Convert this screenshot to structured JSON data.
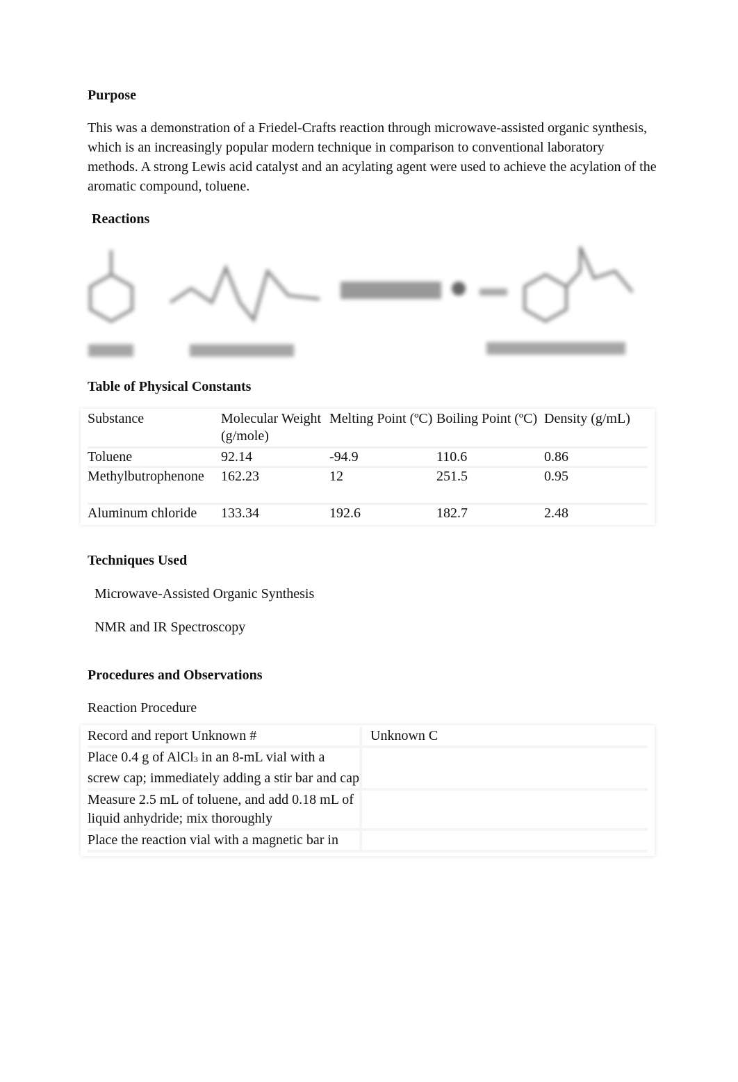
{
  "purpose": {
    "heading": "Purpose",
    "text": "This was a demonstration of a Friedel-Crafts reaction through microwave-assisted organic synthesis, which is an increasingly popular modern technique in comparison to conventional laboratory methods. A strong Lewis acid catalyst and an acylating agent were used to achieve the acylation of the aromatic compound, toluene."
  },
  "reactions": {
    "heading": "Reactions"
  },
  "constants": {
    "heading": "Table of Physical Constants",
    "columns": [
      "Substance",
      "Molecular Weight (g/mole)",
      "Melting Point (ºC)",
      "Boiling Point (ºC)",
      "Density (g/mL)"
    ],
    "rows": [
      [
        "Toluene",
        "92.14",
        "-94.9",
        "110.6",
        "0.86"
      ],
      [
        "Methylbutrophenone",
        "162.23",
        "12",
        "251.5",
        "0.95"
      ],
      [
        "Aluminum chloride",
        "133.34",
        "192.6",
        "182.7",
        "2.48"
      ]
    ]
  },
  "techniques": {
    "heading": "Techniques Used",
    "items": [
      "Microwave-Assisted Organic Synthesis",
      "NMR and IR Spectroscopy"
    ]
  },
  "procedures": {
    "heading": "Procedures and Observations",
    "subheading": "Reaction Procedure",
    "rows": [
      {
        "step": "Record and report Unknown #",
        "obs": "Unknown C"
      },
      {
        "step_pre": "Place 0.4 g of AlCl",
        "step_sub": "3",
        "step_post": " in an 8-mL vial with a screw cap; immediately adding a stir bar and cap",
        "obs": ""
      },
      {
        "step": "Measure 2.5 mL of toluene, and add 0.18 mL of liquid anhydride; mix thoroughly",
        "obs": ""
      },
      {
        "step": "Place the reaction vial with a magnetic bar in",
        "obs": ""
      }
    ]
  }
}
